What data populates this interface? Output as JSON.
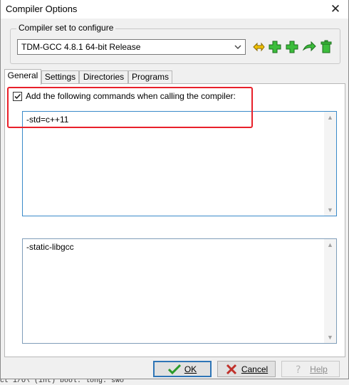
{
  "window": {
    "title": "Compiler Options",
    "close_symbol": "✕"
  },
  "compiler_set": {
    "label": "Compiler set to configure",
    "selected": "TDM-GCC 4.8.1 64-bit Release",
    "toolbar": [
      {
        "name": "rename-set-icon",
        "color": "#e0b000"
      },
      {
        "name": "add-set-icon",
        "color": "#2fae2f"
      },
      {
        "name": "add-folder-set-icon",
        "color": "#2fae2f"
      },
      {
        "name": "find-set-icon",
        "color": "#2fae2f"
      },
      {
        "name": "delete-set-icon",
        "color": "#2fae2f"
      }
    ]
  },
  "tabs": [
    {
      "label": "General",
      "active": true
    },
    {
      "label": "Settings"
    },
    {
      "label": "Directories"
    },
    {
      "label": "Programs"
    }
  ],
  "general": {
    "compiler_commands_checkbox": {
      "label": "Add the following commands when calling the compiler:",
      "checked": true
    },
    "compiler_commands_text": "-std=c++11",
    "linker_commands_text": "-static-libgcc"
  },
  "buttons": {
    "ok": "OK",
    "cancel": "Cancel",
    "help": "Help"
  },
  "background_text": "ct i/O\\ (int) bool. long. swo",
  "accent": {
    "highlight": "#e8202a",
    "ok_icon": "#2a9a2a",
    "cancel_icon": "#c0302a"
  }
}
